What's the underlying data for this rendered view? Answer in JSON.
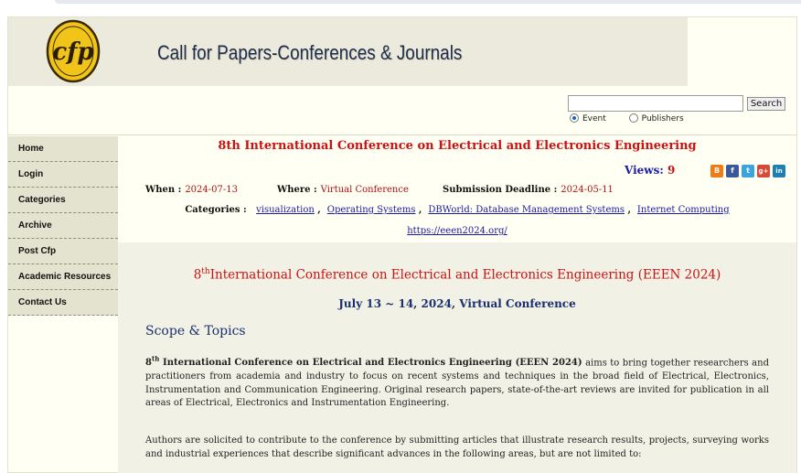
{
  "site": {
    "title": "Call for Papers-Conferences & Journals",
    "logo_text": "cfp"
  },
  "search": {
    "value": "",
    "placeholder": "",
    "button_label": "Search",
    "options": [
      {
        "label": "Event",
        "selected": true
      },
      {
        "label": "Publishers",
        "selected": false
      }
    ]
  },
  "nav": {
    "items": [
      "Home",
      "Login",
      "Categories",
      "Archive",
      "Post Cfp",
      "Academic Resources",
      "Contact Us"
    ]
  },
  "event": {
    "title": "8th International Conference on Electrical and Electronics Engineering",
    "views_label": "Views:",
    "views_count": "9",
    "share_icons": [
      "blogger-icon",
      "facebook-icon",
      "twitter-icon",
      "google-plus-icon",
      "linkedin-icon"
    ],
    "when_label": "When :",
    "when_value": "2024-07-13",
    "where_label": "Where :",
    "where_value": "Virtual Conference",
    "deadline_label": "Submission Deadline :",
    "deadline_value": "2024-05-11",
    "categories_label": "Categories :",
    "categories": [
      "visualization",
      "Operating Systems",
      "DBWorld: Database Management Systems",
      "Internet Computing"
    ],
    "url": "https://eeen2024.org/"
  },
  "body": {
    "heading_prefix": "8",
    "heading_sup": "th",
    "heading_rest": "International Conference on Electrical and Electronics Engineering (EEEN 2024)",
    "dates": "July 13 ~ 14, 2024, Virtual Conference",
    "scope_title": "Scope & Topics",
    "p1_prefix": "8",
    "p1_sup": "th",
    "p1_bold": " International Conference on Electrical and Electronics Engineering (EEEN 2024)",
    "p1_rest": " aims to bring together researchers and practitioners from academia and industry to focus on recent systems and techniques in the broad field of Electrical, Electronics, Instrumentation and Communication Engineering. Original research papers, state-of-the-art reviews are invited for publication in all areas of Electrical, Electronics and Instrumentation Engineering.",
    "p2": "Authors are solicited to contribute to the conference by submitting articles that illustrate research results, projects, surveying works and industrial experiences that describe significant advances in the following areas, but are not limited to:"
  },
  "colors": {
    "accent_red": "#cc1111",
    "link_blue": "#1a1aa0",
    "heading_blue": "#1b2f6e",
    "logo_gold": "#f0c419"
  }
}
